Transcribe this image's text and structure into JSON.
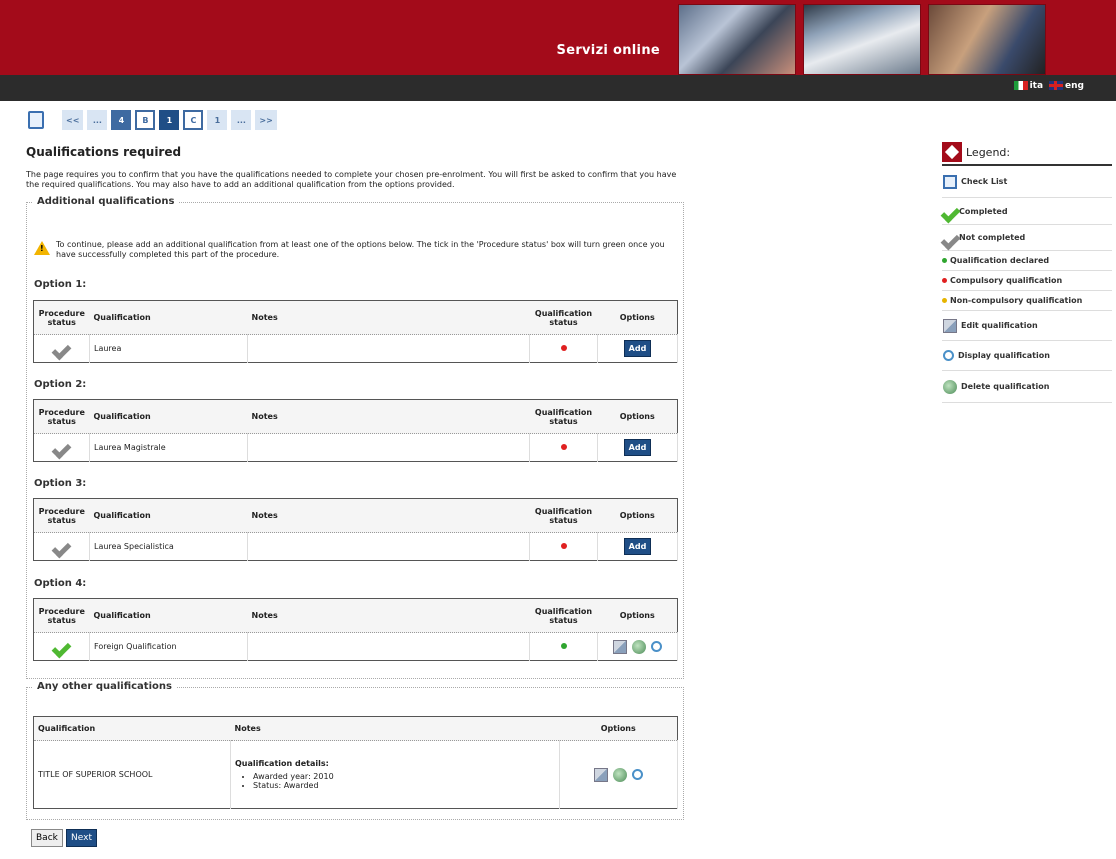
{
  "header": {
    "title": "Servizi online",
    "lang_it": "ita",
    "lang_en": "eng"
  },
  "breadcrumb": {
    "items": [
      "<<",
      "...",
      "4",
      "B",
      "1",
      "C",
      "1",
      "...",
      ">>"
    ]
  },
  "page_title": "Qualifications required",
  "intro_text": "The page requires you to confirm that you have the qualifications needed to complete your chosen pre-enrolment. You will first be asked to confirm that you have the required qualifications. You may also have to add an additional qualification from the options provided.",
  "additional": {
    "legend": "Additional qualifications",
    "warning": "To continue, please add an additional qualification from at least one of the options below. The tick in the 'Procedure status' box will turn green once you have successfully completed this part of the procedure.",
    "headers": {
      "procedure_status": "Procedure status",
      "qualification": "Qualification",
      "notes": "Notes",
      "qualification_status": "Qualification status",
      "options": "Options"
    },
    "add_label": "Add",
    "options": [
      {
        "title": "Option 1:",
        "qualification": "Laurea",
        "completed": false
      },
      {
        "title": "Option 2:",
        "qualification": "Laurea Magistrale",
        "completed": false
      },
      {
        "title": "Option 3:",
        "qualification": "Laurea Specialistica",
        "completed": false
      },
      {
        "title": "Option 4:",
        "qualification": "Foreign Qualification",
        "completed": true
      }
    ]
  },
  "other": {
    "legend": "Any other qualifications",
    "headers": {
      "qualification": "Qualification",
      "notes": "Notes",
      "options": "Options"
    },
    "row": {
      "qualification": "TITLE OF SUPERIOR SCHOOL",
      "details_title": "Qualification details:",
      "awarded_year": "Awarded year: 2010",
      "status": "Status: Awarded"
    }
  },
  "buttons": {
    "back": "Back",
    "next": "Next"
  },
  "legend": {
    "title": "Legend:",
    "check_list": "Check List",
    "completed": "Completed",
    "not_completed": "Not completed",
    "declared": "Qualification declared",
    "compulsory": "Compulsory qualification",
    "non_compulsory": "Non-compulsory qualification",
    "edit": "Edit qualification",
    "display": "Display qualification",
    "delete": "Delete qualification"
  }
}
